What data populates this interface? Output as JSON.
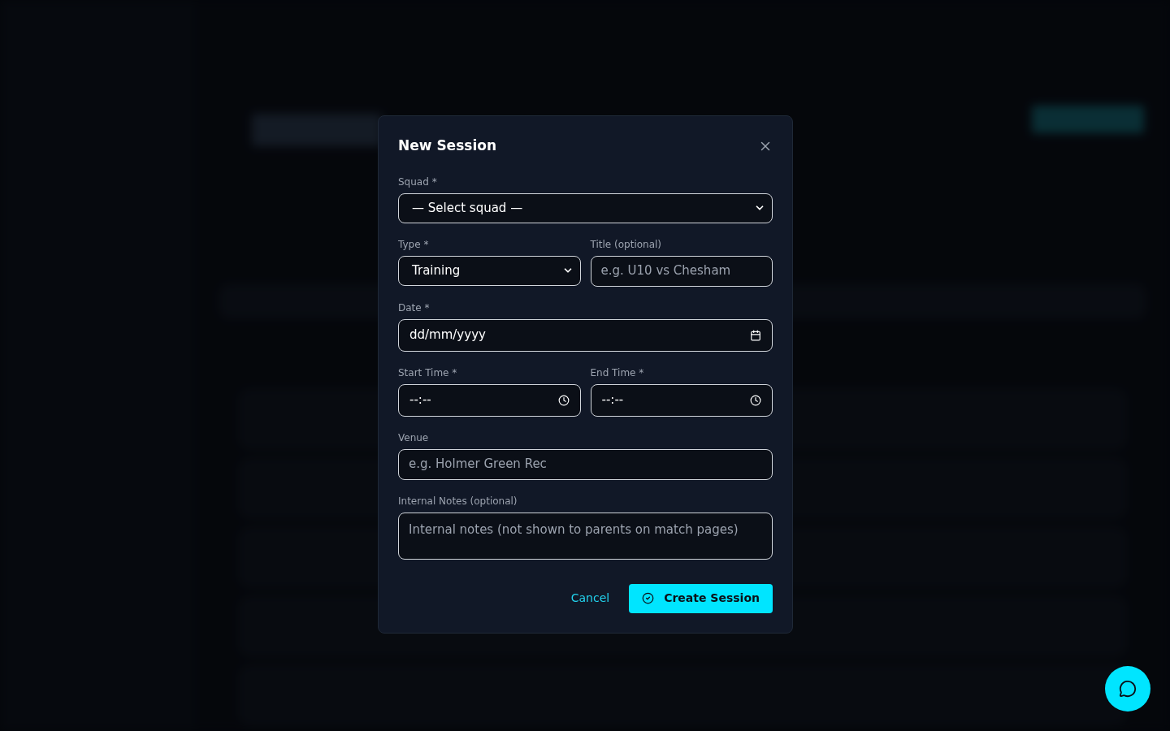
{
  "dialog": {
    "title": "New Session"
  },
  "rows": [
    [
      {
        "kind": "select",
        "label": "Squad *",
        "value": "— Select squad —"
      }
    ],
    [
      {
        "kind": "select",
        "label": "Type *",
        "value": "Training"
      },
      {
        "kind": "text",
        "label": "Title (optional)",
        "placeholder": "e.g. U10 vs Chesham"
      }
    ],
    [
      {
        "kind": "date",
        "label": "Date *",
        "value": "dd/mm/yyyy"
      }
    ],
    [
      {
        "kind": "time",
        "label": "Start Time *",
        "value": "--:--"
      },
      {
        "kind": "time",
        "label": "End Time *",
        "value": "--:--"
      }
    ],
    [
      {
        "kind": "text",
        "label": "Venue",
        "placeholder": "e.g. Holmer Green Rec"
      }
    ],
    [
      {
        "kind": "textarea",
        "label": "Internal Notes (optional)",
        "placeholder": "Internal notes (not shown to parents on match pages)"
      }
    ]
  ],
  "buttons": [
    {
      "kind": "link",
      "label": "Cancel"
    },
    {
      "kind": "primary",
      "label": "Create Session"
    }
  ]
}
